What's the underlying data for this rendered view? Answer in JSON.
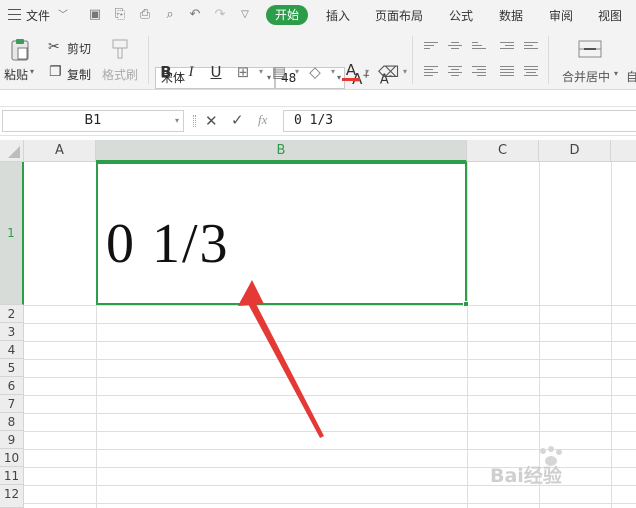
{
  "menubar": {
    "file_label": "文件",
    "tabs": [
      "开始",
      "插入",
      "页面布局",
      "公式",
      "数据",
      "审阅",
      "视图"
    ],
    "active_tab": "开始"
  },
  "ribbon": {
    "paste_label": "粘贴",
    "cut_label": "剪切",
    "copy_label": "复制",
    "format_painter_label": "格式刷",
    "font_name": "宋体",
    "font_size": "48",
    "bold": "B",
    "italic": "I",
    "underline": "U",
    "font_color": "A",
    "grow_font": "A",
    "shrink_font": "A",
    "merge_center_label": "合并居中",
    "more_label": "自"
  },
  "formula_bar": {
    "name_box": "B1",
    "fx_label": "fx",
    "formula_value": "0 1/3"
  },
  "sheet": {
    "columns": [
      "A",
      "B",
      "C",
      "D"
    ],
    "rows": [
      "1",
      "2",
      "3",
      "4",
      "5",
      "6",
      "7",
      "8",
      "9",
      "10",
      "11",
      "12"
    ],
    "cell_b1": "0 1/3"
  },
  "watermark": {
    "text": "Bai经验"
  },
  "colors": {
    "accent": "#2e9d4b",
    "arrow": "#e53935"
  }
}
